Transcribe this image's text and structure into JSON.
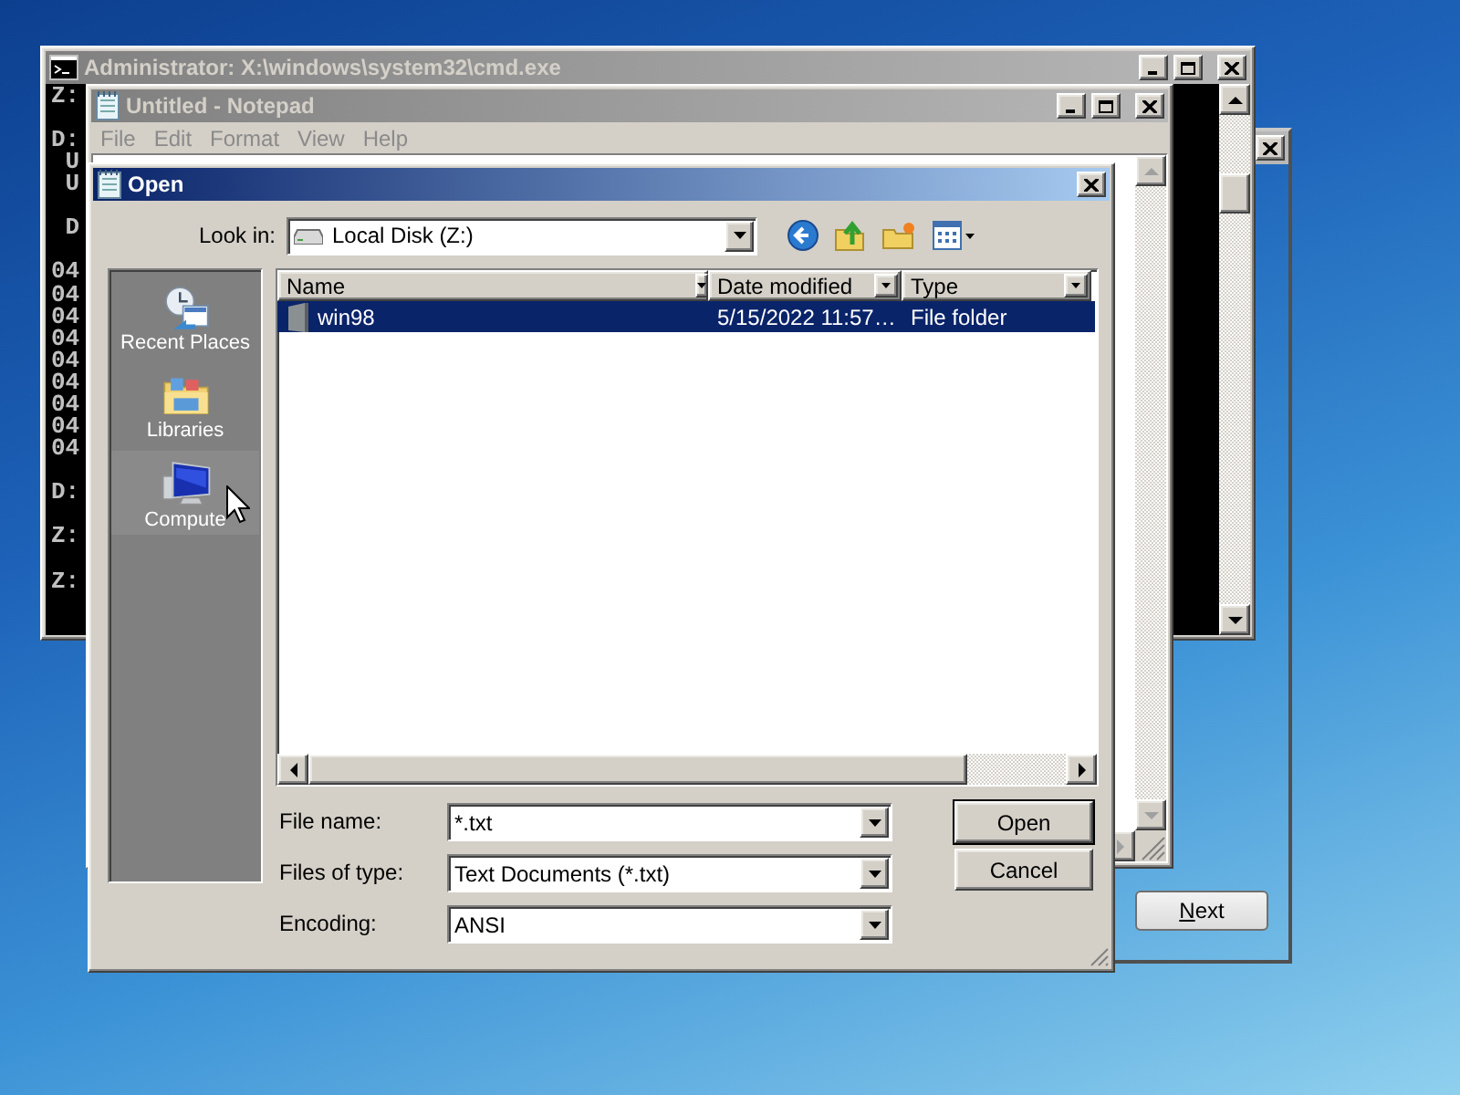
{
  "setup_window": {
    "active": false,
    "next_button": "Next"
  },
  "cmd_window": {
    "title": "Administrator: X:\\windows\\system32\\cmd.exe",
    "active": false,
    "blocks": [
      {
        "lines": [
          "Z:"
        ]
      },
      {
        "lines": [
          "D:",
          " U",
          " U"
        ]
      },
      {
        "lines": [
          " D"
        ]
      },
      {
        "lines": [
          "04",
          "04",
          "04",
          "04",
          "04",
          "04",
          "04",
          "04",
          "04"
        ]
      },
      {
        "lines": [
          "D:"
        ]
      },
      {
        "lines": [
          "Z:"
        ]
      },
      {
        "lines": [
          "Z:"
        ]
      }
    ]
  },
  "notepad_window": {
    "title": "Untitled - Notepad",
    "active": false,
    "menu": [
      "File",
      "Edit",
      "Format",
      "View",
      "Help"
    ]
  },
  "open_dialog": {
    "title": "Open",
    "active": true,
    "look_in": {
      "label": "Look in:",
      "value": "Local Disk (Z:)"
    },
    "places": [
      {
        "label": "Recent Places",
        "kind": "recent",
        "selected": false
      },
      {
        "label": "Libraries",
        "kind": "libraries",
        "selected": false
      },
      {
        "label": "Compute",
        "kind": "computer",
        "selected": true
      }
    ],
    "columns": [
      "Name",
      "Date modified",
      "Type"
    ],
    "rows": [
      {
        "name": "win98",
        "date_modified": "5/15/2022 11:57…",
        "type": "File folder",
        "selected": true
      }
    ],
    "fields": [
      {
        "label": "File name:",
        "value": "*.txt"
      },
      {
        "label": "Files of type:",
        "value": "Text Documents (*.txt)"
      },
      {
        "label": "Encoding:",
        "value": "ANSI"
      }
    ],
    "buttons": [
      "Open",
      "Cancel"
    ]
  }
}
